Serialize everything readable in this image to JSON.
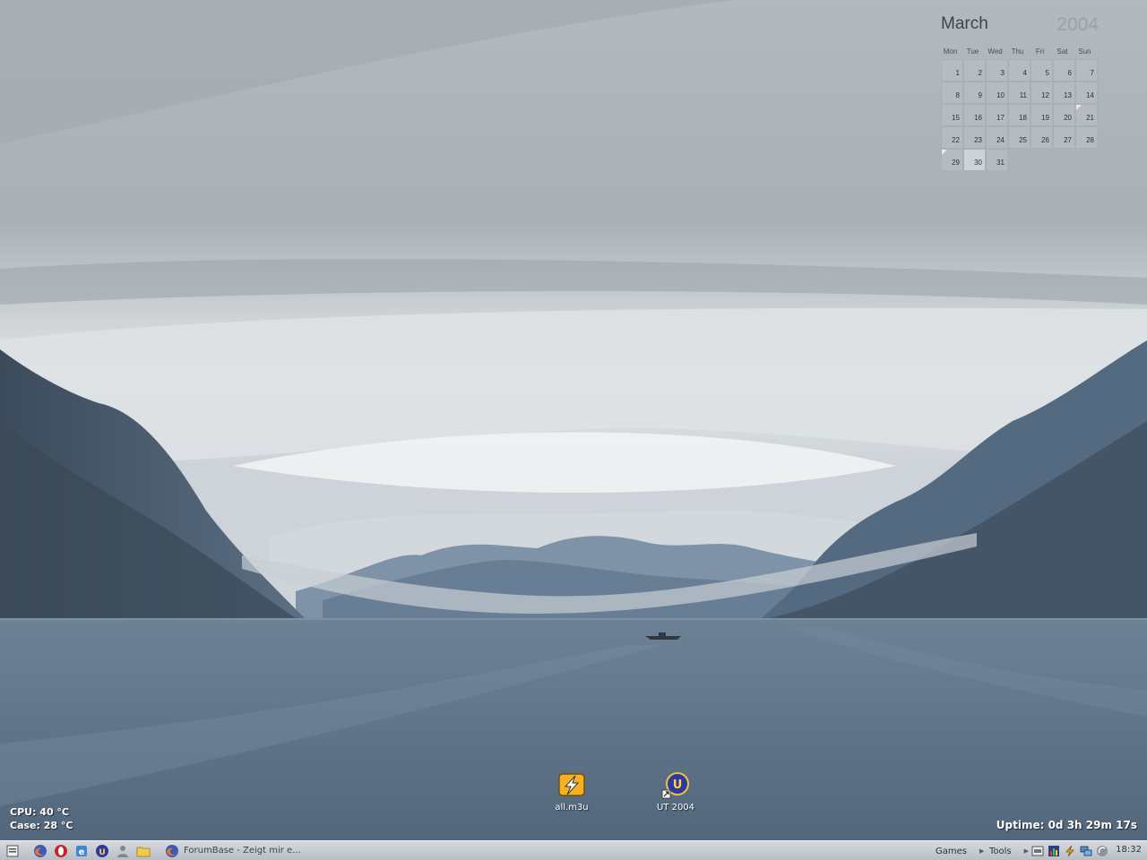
{
  "calendar": {
    "month": "March",
    "year": "2004",
    "weekdays": [
      "Mon",
      "Tue",
      "Wed",
      "Thu",
      "Fri",
      "Sat",
      "Sun"
    ],
    "days": [
      "1",
      "2",
      "3",
      "4",
      "5",
      "6",
      "7",
      "8",
      "9",
      "10",
      "11",
      "12",
      "13",
      "14",
      "15",
      "16",
      "17",
      "18",
      "19",
      "20",
      "21",
      "22",
      "23",
      "24",
      "25",
      "26",
      "27",
      "28",
      "29",
      "30",
      "31"
    ],
    "today": "30"
  },
  "desktop_icons": [
    {
      "label": "all.m3u",
      "icon": "winamp-playlist-icon"
    },
    {
      "label": "UT 2004",
      "icon": "unreal-tournament-shortcut-icon"
    }
  ],
  "sensors": {
    "cpu": "CPU: 40 °C",
    "case": "Case: 28 °C",
    "uptime": "Uptime: 0d 3h 29m 17s"
  },
  "taskbar": {
    "quick_launch": [
      "firefox-icon",
      "opera-icon",
      "internet-explorer-icon",
      "unreal-icon",
      "user-icon",
      "folder-icon"
    ],
    "task_title": "ForumBase - Zeigt mir e...",
    "menus": [
      "Games",
      "Tools"
    ],
    "tray": [
      "network-icon",
      "meter-icon",
      "winamp-icon",
      "display-icon",
      "volume-icon"
    ],
    "clock": "18:32"
  },
  "colors": {
    "sky": "#b9bec2",
    "water": "#5f7389",
    "mountains": "#4d5f73"
  }
}
